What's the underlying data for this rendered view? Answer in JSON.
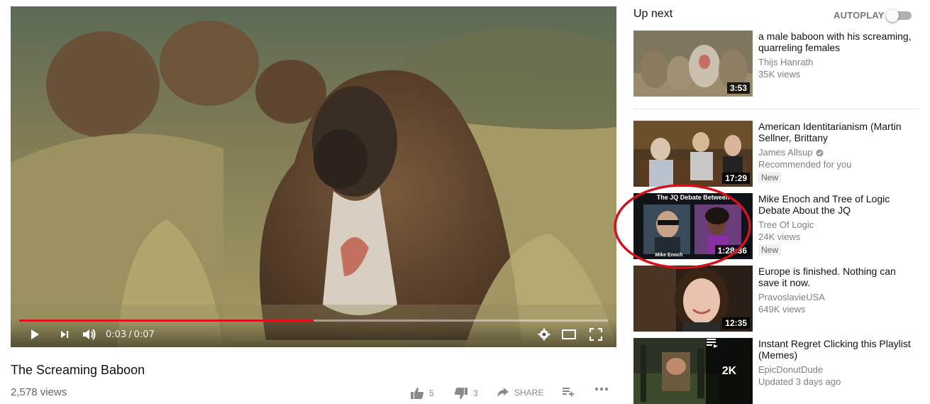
{
  "player": {
    "progress_fraction": 0.5,
    "time_current": "0:03",
    "time_separator": "/",
    "time_total": "0:07",
    "accent_color": "#e4121b"
  },
  "video": {
    "title": "The Screaming Baboon",
    "views": "2,578 views",
    "likes": "5",
    "dislikes": "3",
    "share_label": "SHARE"
  },
  "sidebar": {
    "up_next_label": "Up next",
    "autoplay_label": "AUTOPLAY",
    "autoplay_on": false,
    "items": [
      {
        "title": "a male baboon with his screaming, quarreling females",
        "channel": "Thijs Hanrath",
        "verified": false,
        "stats": "35K views",
        "badge": "",
        "duration": "3:53"
      },
      {
        "title": "American Identitarianism (Martin Sellner, Brittany",
        "channel": "James Allsup",
        "verified": true,
        "stats": "Recommended for you",
        "badge": "New",
        "duration": "17:29"
      },
      {
        "title": "Mike Enoch and Tree of Logic Debate About the JQ",
        "channel": "Tree Of Logic",
        "verified": false,
        "stats": "24K views",
        "badge": "New",
        "duration": "1:28:36",
        "thumb_title": "The JQ Debate Between",
        "thumb_caption": "Mike Enoch"
      },
      {
        "title": "Europe is finished. Nothing can save it now.",
        "channel": "PravoslavieUSA",
        "verified": false,
        "stats": "649K views",
        "badge": "",
        "duration": "12:35"
      },
      {
        "title": "Instant Regret Clicking this Playlist (Memes)",
        "channel": "EpicDonutDude",
        "verified": false,
        "stats": "Updated 3 days ago",
        "badge": "",
        "playlist_count": "2K"
      }
    ]
  },
  "icons": [
    "play-icon",
    "next-icon",
    "volume-icon",
    "settings-gear-icon",
    "theater-mode-icon",
    "fullscreen-icon",
    "thumbs-up-icon",
    "thumbs-down-icon",
    "share-icon",
    "add-to-playlist-icon",
    "more-icon",
    "verified-check-icon",
    "playlist-icon"
  ],
  "annotation": {
    "color": "#d4121b"
  }
}
